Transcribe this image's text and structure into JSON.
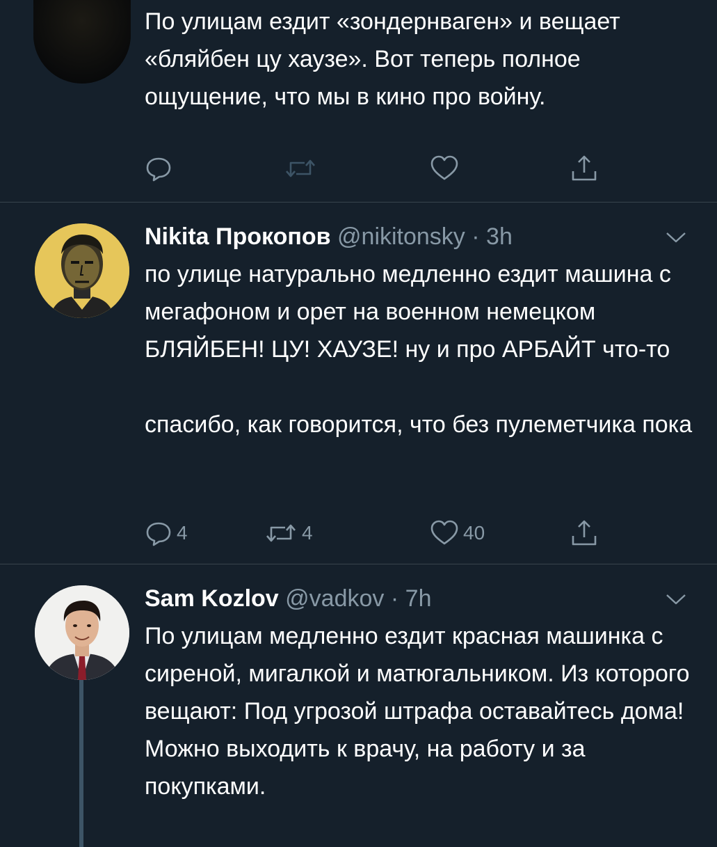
{
  "tweets": [
    {
      "text": "По улицам ездит «зондернваген» и вещает «бляйбен цу хаузе». Вот теперь полное ощущение, что мы в кино про войну.",
      "reply_count": "",
      "retweet_count": "",
      "like_count": ""
    },
    {
      "name": "Nikita Прокопов",
      "handle": "@nikitonsky",
      "separator": "·",
      "time": "3h",
      "text": "по улице натурально медленно ездит машина с мегафоном и орет на военном немецком БЛЯЙБЕН! ЦУ! ХАУЗЕ! ну и про АРБАЙТ что-то\n\nспасибо, как говорится, что без пулеметчика пока",
      "reply_count": "4",
      "retweet_count": "4",
      "like_count": "40"
    },
    {
      "name": "Sam Kozlov",
      "handle": "@vadkov",
      "separator": "·",
      "time": "7h",
      "text": "По улицам медленно ездит красная машинка с сиреной, мигалкой и матюгальником. Из которого вещают: Под угрозой штрафа оставайтесь дома! Можно выходить к врачу, на работу и за покупками."
    }
  ],
  "icons": {
    "reply": "reply-icon",
    "retweet": "retweet-icon",
    "like": "heart-icon",
    "share": "share-icon",
    "more": "chevron-down-icon"
  },
  "colors": {
    "background": "#15202b",
    "secondary_text": "#8899a6",
    "divider": "#38444d",
    "thread_line": "#3d5466"
  }
}
